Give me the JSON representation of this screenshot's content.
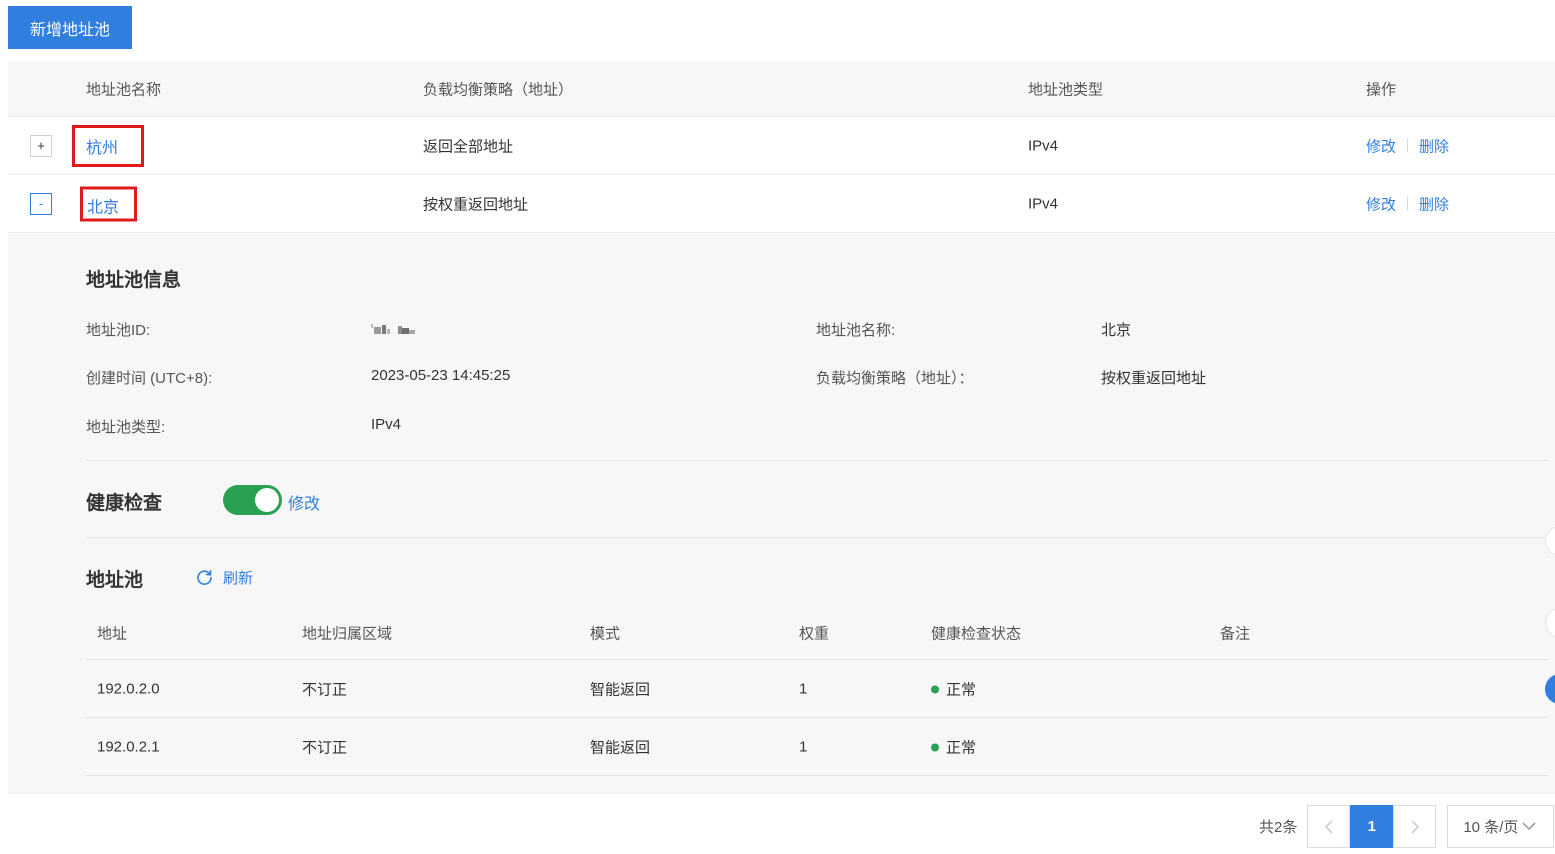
{
  "toolbar": {
    "add_pool_label": "新增地址池"
  },
  "main_table": {
    "headers": [
      "地址池名称",
      "负载均衡策略（地址）",
      "地址池类型",
      "操作"
    ],
    "rows": [
      {
        "expander": "+",
        "name": "杭州",
        "strategy": "返回全部地址",
        "type": "IPv4",
        "edit": "修改",
        "delete": "删除"
      },
      {
        "expander": "-",
        "name": "北京",
        "strategy": "按权重返回地址",
        "type": "IPv4",
        "edit": "修改",
        "delete": "删除"
      }
    ]
  },
  "detail": {
    "info_title": "地址池信息",
    "fields": {
      "pool_id_label": "地址池ID:",
      "pool_name_label": "地址池名称:",
      "pool_name_value": "北京",
      "created_label": "创建时间 (UTC+8):",
      "created_value": "2023-05-23 14:45:25",
      "strategy_label": "负载均衡策略（地址）：",
      "strategy_value": "按权重返回地址",
      "type_label": "地址池类型:",
      "type_value": "IPv4"
    },
    "health_title": "健康检查",
    "health_enabled": true,
    "health_edit": "修改",
    "pool_title": "地址池",
    "refresh_label": "刷新",
    "sub_table": {
      "headers": [
        "地址",
        "地址归属区域",
        "模式",
        "权重",
        "健康检查状态",
        "备注"
      ],
      "rows": [
        {
          "address": "192.0.2.0",
          "region": "不订正",
          "mode": "智能返回",
          "weight": "1",
          "status": "正常",
          "note": ""
        },
        {
          "address": "192.0.2.1",
          "region": "不订正",
          "mode": "智能返回",
          "weight": "1",
          "status": "正常",
          "note": ""
        }
      ]
    }
  },
  "pagination": {
    "total": "共2条",
    "current_page": "1",
    "page_size": "10 条/页"
  },
  "colors": {
    "primary": "#2f7ee0",
    "success": "#2aa052",
    "highlight_border": "#e01a1a"
  }
}
